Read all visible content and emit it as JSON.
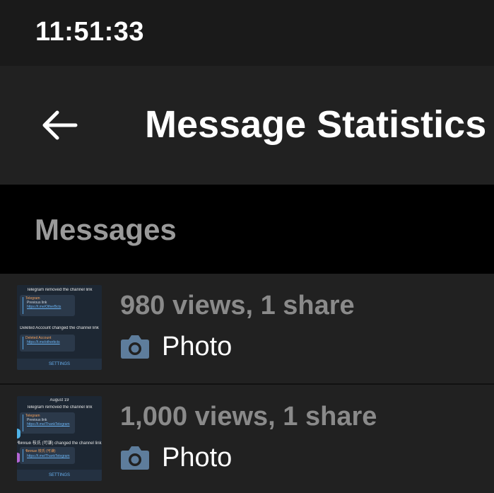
{
  "status_bar": {
    "time": "11:51:33"
  },
  "header": {
    "title": "Message Statistics",
    "back_icon": "arrow-left-icon"
  },
  "section": {
    "title": "Messages"
  },
  "messages": [
    {
      "stats": "980 views, 1 share",
      "type_icon": "camera-icon",
      "type_label": "Photo",
      "thumbnail": {
        "line1": "Telegram removed the channel link",
        "bubble1": {
          "name": "Telegram",
          "text": "Previous link",
          "link": "https://t.me/OtherBcts",
          "time": "19:46"
        },
        "line2": "Deleted Account changed the channel link",
        "bubble2": {
          "name": "Deleted Account",
          "link": "https://t.me/otherbcts",
          "time": "19:53"
        },
        "button": "SETTINGS"
      }
    },
    {
      "stats": "1,000 views, 1 share",
      "type_icon": "camera-icon",
      "type_label": "Photo",
      "thumbnail": {
        "date": "August 19",
        "line1": "Telegram removed the channel link",
        "bubble1": {
          "name": "Telegram",
          "text": "Previous link",
          "link": "https://t.me/ThankTelegram",
          "time": "19:48"
        },
        "line2": "ชิตหมด 枝氏 (可谦) changed the channel link",
        "bubble2": {
          "name": "ชิตหมด 枝氏 (可谦)",
          "link": "https://t.me/ThankTelegram",
          "time": "19:51"
        },
        "button": "SETTINGS"
      }
    }
  ],
  "colors": {
    "status_bar_bg": "#1a1a1a",
    "app_bar_bg": "#212121",
    "row_bg": "#212121",
    "stats_text": "#8a8a8a",
    "section_text": "#9a9a9a",
    "camera_icon": "#5e7d9c"
  }
}
